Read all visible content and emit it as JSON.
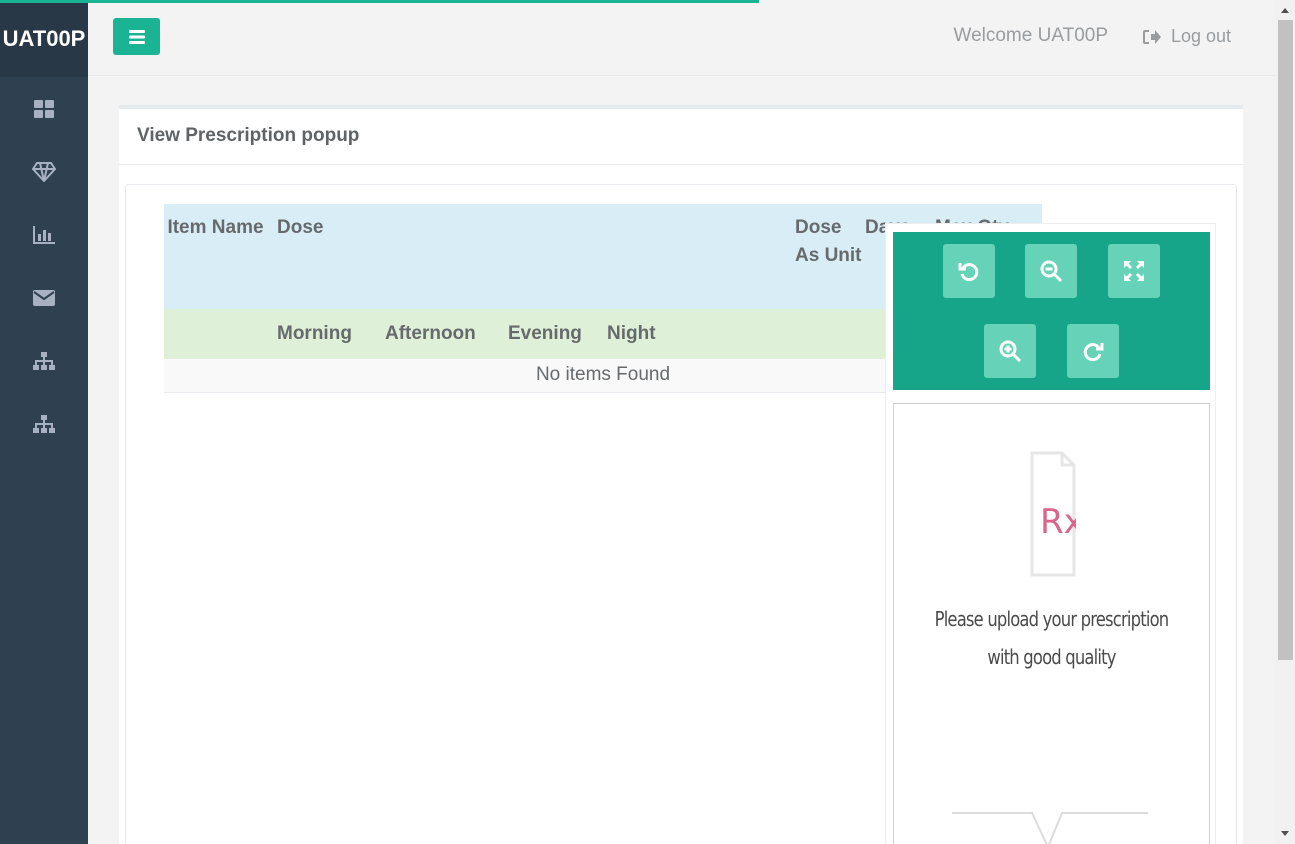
{
  "app": {
    "brand": "UAT00P"
  },
  "header": {
    "welcome": "Welcome UAT00P",
    "logout_label": "Log out"
  },
  "sidebar": {
    "items": [
      {
        "icon": "dashboard-icon"
      },
      {
        "icon": "diamond-icon"
      },
      {
        "icon": "bar-chart-icon"
      },
      {
        "icon": "envelope-icon"
      },
      {
        "icon": "sitemap-icon"
      },
      {
        "icon": "sitemap-icon"
      }
    ]
  },
  "page": {
    "title": "View Prescription popup"
  },
  "table": {
    "headers": {
      "item_name": "Item Name",
      "dose": "Dose",
      "dose_as_unit": "Dose As Unit",
      "days": "Days",
      "max_qty": "Max Qty"
    },
    "subheaders": {
      "morning": "Morning",
      "afternoon": "Afternoon",
      "evening": "Evening",
      "night": "Night"
    },
    "empty_message": "No items Found"
  },
  "viewer": {
    "buttons": [
      "rotate-left-icon",
      "zoom-out-icon",
      "fullscreen-icon",
      "zoom-in-icon",
      "rotate-right-icon"
    ],
    "placeholder_line1": "Please upload your prescription",
    "placeholder_line2": "with good quality",
    "placeholder_symbol": "Rx"
  },
  "colors": {
    "accent": "#1ab394",
    "sidebar": "#2f4050",
    "viewer_toolbar": "#16a589"
  }
}
